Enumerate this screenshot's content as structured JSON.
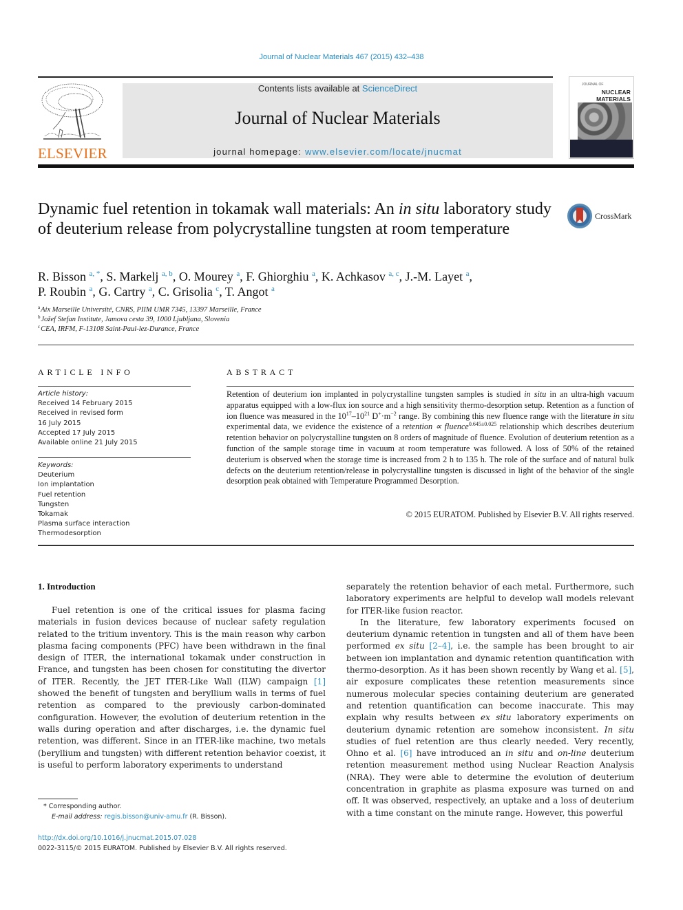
{
  "running_head": "Journal of Nuclear Materials 467 (2015) 432–438",
  "publisher": {
    "name": "ELSEVIER",
    "logo_icon": "elsevier-tree-icon"
  },
  "banner": {
    "contents_prefix": "Contents lists available at ",
    "contents_link": "ScienceDirect",
    "journal_name": "Journal of Nuclear Materials",
    "homepage_prefix": "journal homepage: ",
    "homepage_link": "www.elsevier.com/locate/jnucmat"
  },
  "cover": {
    "title_small": "JOURNAL OF",
    "title": "NUCLEAR MATERIALS"
  },
  "colors": {
    "link": "#2a8cc0",
    "elsevier_orange": "#e9711c",
    "crossmark_red": "#c0392b",
    "crossmark_blue": "#3b6ea0"
  },
  "article": {
    "title_part1": "Dynamic fuel retention in tokamak wall materials: An ",
    "title_italic": "in situ",
    "title_part2": " laboratory study of deuterium release from polycrystalline tungsten at room temperature",
    "crossmark_label": "CrossMark",
    "authors": [
      {
        "name": "R. Bisson",
        "aff": "a, *",
        "sep": ", "
      },
      {
        "name": "S. Markelj",
        "aff": "a, b",
        "sep": ", "
      },
      {
        "name": "O. Mourey",
        "aff": "a",
        "sep": ", "
      },
      {
        "name": "F. Ghiorghiu",
        "aff": "a",
        "sep": ", "
      },
      {
        "name": "K. Achkasov",
        "aff": "a, c",
        "sep": ", "
      },
      {
        "name": "J.-M. Layet",
        "aff": "a",
        "sep": ", "
      },
      {
        "name": "P. Roubin",
        "aff": "a",
        "sep": ", "
      },
      {
        "name": "G. Cartry",
        "aff": "a",
        "sep": ", "
      },
      {
        "name": "C. Grisolia",
        "aff": "c",
        "sep": ", "
      },
      {
        "name": "T. Angot",
        "aff": "a",
        "sep": ""
      }
    ],
    "affiliations": [
      {
        "key": "a",
        "text": "Aix Marseille Université, CNRS, PIIM UMR 7345, 13397 Marseille, France"
      },
      {
        "key": "b",
        "text": "Jožef Stefan Institute, Jamova cesta 39, 1000 Ljubljana, Slovenia"
      },
      {
        "key": "c",
        "text": "CEA, IRFM, F-13108 Saint-Paul-lez-Durance, France"
      }
    ]
  },
  "article_info": {
    "label": "ARTICLE INFO",
    "history_heading": "Article history:",
    "history": [
      "Received 14 February 2015",
      "Received in revised form",
      "16 July 2015",
      "Accepted 17 July 2015",
      "Available online 21 July 2015"
    ],
    "keywords_heading": "Keywords:",
    "keywords": [
      "Deuterium",
      "Ion implantation",
      "Fuel retention",
      "Tungsten",
      "Tokamak",
      "Plasma surface interaction",
      "Thermodesorption"
    ]
  },
  "abstract": {
    "label": "ABSTRACT",
    "s1": "Retention of deuterium ion implanted in polycrystalline tungsten samples is studied ",
    "s1_i": "in situ",
    "s2": " in an ultra-high vacuum apparatus equipped with a low-flux ion source and a high sensitivity thermo-desorption setup. Retention as a function of ion fluence was measured in the 10",
    "exp1": "17",
    "s3": "–10",
    "exp2": "21",
    "s4": " D",
    "exp3": "+",
    "s5": "·m",
    "exp4": "−2",
    "s6": " range. By combining this new fluence range with the literature ",
    "s6_i": "in situ",
    "s7": " experimental data, we evidence the existence of a ",
    "s7_i": "retention ∝ fluence",
    "exp5": "0.645±0.025",
    "s8": " relationship which describes deuterium retention behavior on polycrystalline tungsten on 8 orders of magnitude of fluence. Evolution of deuterium retention as a function of the sample storage time in vacuum at room temperature was followed. A loss of 50% of the retained deuterium is observed when the storage time is increased from 2 h to 135 h. The role of the surface and of natural bulk defects on the deuterium retention/release in polycrystalline tungsten is discussed in light of the behavior of the single desorption peak obtained with Temperature Programmed Desorption.",
    "copyright": "© 2015 EURATOM. Published by Elsevier B.V. All rights reserved."
  },
  "introduction": {
    "heading": "1.  Introduction",
    "left_p1_a": "Fuel retention is one of the critical issues for plasma facing materials in fusion devices because of nuclear safety regulation related to the tritium inventory. This is the main reason why carbon plasma facing components (PFC) have been withdrawn in the final design of ITER, the international tokamak under construction in France, and tungsten has been chosen for constituting the divertor of ITER. Recently, the JET ITER-Like Wall (ILW) campaign ",
    "left_ref1": "[1]",
    "left_p1_b": " showed the benefit of tungsten and beryllium walls in terms of fuel retention as compared to the previously carbon-dominated configuration. However, the evolution of deuterium retention in the walls during operation and after discharges, i.e. the dynamic fuel retention, was different. Since in an ITER-like machine, two metals (beryllium and tungsten) with different retention behavior coexist, it is useful to perform laboratory experiments to understand",
    "right_p1": "separately the retention behavior of each metal. Furthermore, such laboratory experiments are helpful to develop wall models relevant for ITER-like fusion reactor.",
    "right_p2_a": "In the literature, few laboratory experiments focused on deuterium dynamic retention in tungsten and all of them have been performed ",
    "right_p2_i1": "ex situ",
    "right_p2_ref1": "[2–4]",
    "right_p2_b": ", i.e. the sample has been brought to air between ion implantation and dynamic retention quantification with thermo-desorption. As it has been shown recently by Wang et al. ",
    "right_p2_ref2": "[5]",
    "right_p2_c": ", air exposure complicates these retention measurements since numerous molecular species containing deuterium are generated and retention quantification can become inaccurate. This may explain why results between ",
    "right_p2_i2": "ex situ",
    "right_p2_d": " laboratory experiments on deuterium dynamic retention are somehow inconsistent. ",
    "right_p2_i3": "In situ",
    "right_p2_e": " studies of fuel retention are thus clearly needed. Very recently, Ohno et al. ",
    "right_p2_ref3": "[6]",
    "right_p2_f": " have introduced an ",
    "right_p2_i4": "in situ",
    "right_p2_g": " and ",
    "right_p2_i5": "on-line",
    "right_p2_h": " deuterium retention measurement method using Nuclear Reaction Analysis (NRA). They were able to determine the evolution of deuterium concentration in graphite as plasma exposure was turned on and off. It was observed, respectively, an uptake and a loss of deuterium with a time constant on the minute range. However, this powerful"
  },
  "footnote": {
    "star_text": "* Corresponding author.",
    "email_label": "E-mail address: ",
    "email": "regis.bisson@univ-amu.fr",
    "email_suffix": " (R. Bisson).",
    "doi": "http://dx.doi.org/10.1016/j.jnucmat.2015.07.028",
    "issn_line": "0022-3115/© 2015 EURATOM. Published by Elsevier B.V. All rights reserved."
  }
}
